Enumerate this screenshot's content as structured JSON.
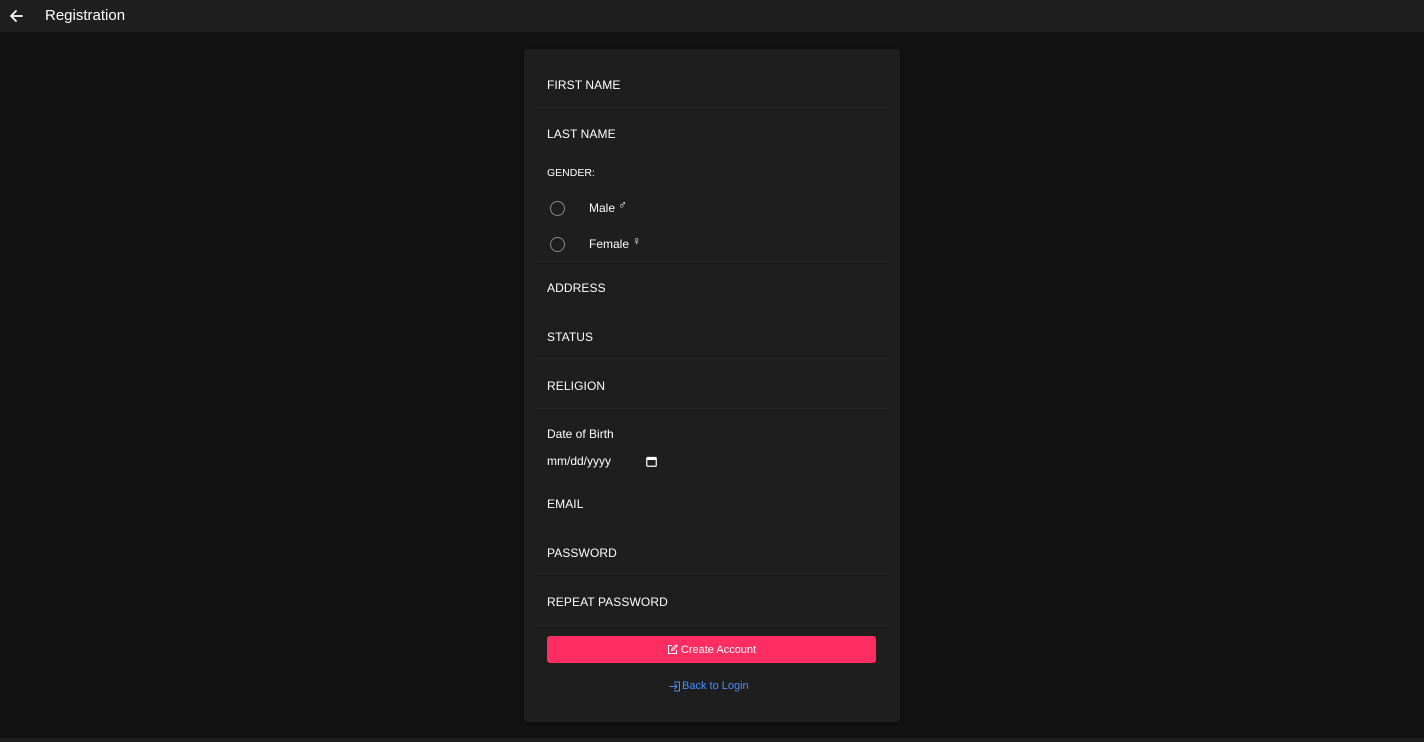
{
  "toolbar": {
    "title": "Registration",
    "back_icon": "arrow-left-icon"
  },
  "form": {
    "first_name_label": "FIRST NAME",
    "last_name_label": "LAST NAME",
    "gender_label": "GENDER:",
    "gender_options": [
      {
        "label": "Male",
        "symbol": "♂",
        "selected": false
      },
      {
        "label": "Female",
        "symbol": "♀",
        "selected": false
      }
    ],
    "address_label": "ADDRESS",
    "status_label": "STATUS",
    "religion_label": "RELIGION",
    "dob_label": "Date of Birth",
    "dob_placeholder": "mm/dd/yyyy",
    "email_label": "EMAIL",
    "password_label": "PASSWORD",
    "repeat_password_label": "REPEAT PASSWORD",
    "create_button": "Create Account",
    "back_to_login": "Back to Login"
  },
  "colors": {
    "background": "#121212",
    "toolbar": "#1f1f1f",
    "card": "#1e1e1e",
    "primary_button": "#ff2d62",
    "link": "#4b8dff"
  }
}
